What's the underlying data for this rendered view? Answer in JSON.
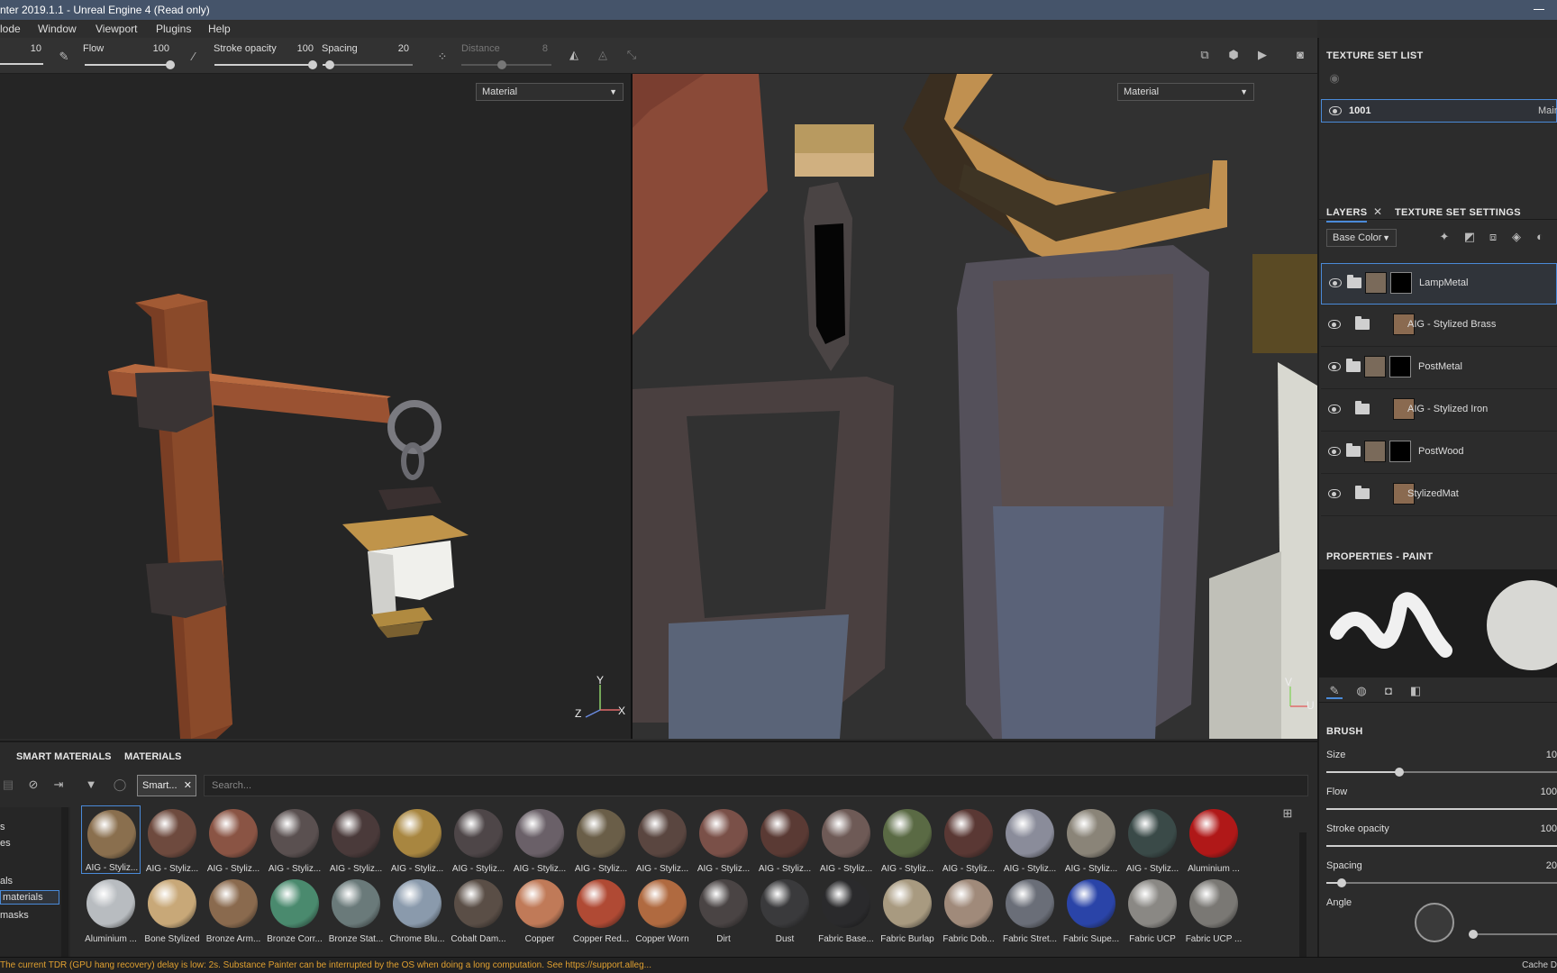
{
  "window": {
    "title": "nter 2019.1.1 - Unreal Engine 4 (Read only)"
  },
  "menu": [
    "lode",
    "Window",
    "Viewport",
    "Plugins",
    "Help"
  ],
  "toolbar": {
    "size_value": "10",
    "flow_label": "Flow",
    "flow_value": "100",
    "stroke_label": "Stroke opacity",
    "stroke_value": "100",
    "spacing_label": "Spacing",
    "spacing_value": "20",
    "distance_label": "Distance",
    "distance_value": "8"
  },
  "viewport3d": {
    "mode": "Material",
    "axes": {
      "y": "Y",
      "z": "Z",
      "x": "X"
    }
  },
  "viewport2d": {
    "mode": "Material",
    "axes": {
      "v": "V",
      "u": "U"
    }
  },
  "texture_set_list": {
    "title": "TEXTURE SET LIST",
    "row_name": "1001",
    "row_shader": "Main"
  },
  "layers": {
    "tab_layers": "LAYERS",
    "tab_settings": "TEXTURE SET SETTINGS",
    "channel": "Base Color",
    "items": [
      {
        "name": "LampMetal",
        "folder": true,
        "mask": true
      },
      {
        "name": "AIG - Stylized Brass",
        "folder": false,
        "mask": false
      },
      {
        "name": "PostMetal",
        "folder": true,
        "mask": true
      },
      {
        "name": "AIG - Stylized Iron",
        "folder": false,
        "mask": false
      },
      {
        "name": "PostWood",
        "folder": true,
        "mask": true
      },
      {
        "name": "StylizedMat",
        "folder": false,
        "mask": false
      }
    ]
  },
  "properties": {
    "title": "PROPERTIES - PAINT",
    "brush_title": "BRUSH",
    "size_label": "Size",
    "size_value": "10",
    "flow_label": "Flow",
    "flow_value": "100",
    "stroke_label": "Stroke opacity",
    "stroke_value": "100",
    "spacing_label": "Spacing",
    "spacing_value": "20",
    "angle_label": "Angle"
  },
  "shelf": {
    "tab_smart": "SMART MATERIALS",
    "tab_materials": "MATERIALS",
    "filter_chip": "Smart...",
    "search_placeholder": "Search...",
    "side_items": [
      "s",
      "es",
      "als",
      "materials",
      "masks"
    ],
    "row1": [
      {
        "label": "AIG - Styliz...",
        "color": "#8a6f4e"
      },
      {
        "label": "AIG - Styliz...",
        "color": "#6e4a3e"
      },
      {
        "label": "AIG - Styliz...",
        "color": "#8a5444"
      },
      {
        "label": "AIG - Styliz...",
        "color": "#5a5050"
      },
      {
        "label": "AIG - Styliz...",
        "color": "#4a3a3a"
      },
      {
        "label": "AIG - Styliz...",
        "color": "#a88640"
      },
      {
        "label": "AIG - Styliz...",
        "color": "#4e4648"
      },
      {
        "label": "AIG - Styliz...",
        "color": "#6a6068"
      },
      {
        "label": "AIG - Styliz...",
        "color": "#6a5e48"
      },
      {
        "label": "AIG - Styliz...",
        "color": "#5a4640"
      },
      {
        "label": "AIG - Styliz...",
        "color": "#7a5048"
      },
      {
        "label": "AIG - Styliz...",
        "color": "#5a3a34"
      },
      {
        "label": "AIG - Styliz...",
        "color": "#6e5a56"
      },
      {
        "label": "AIG - Styliz...",
        "color": "#5a6a44"
      },
      {
        "label": "AIG - Styliz...",
        "color": "#5a3834"
      },
      {
        "label": "AIG - Styliz...",
        "color": "#8a8c9a"
      },
      {
        "label": "AIG - Styliz...",
        "color": "#8a8478"
      },
      {
        "label": "AIG - Styliz...",
        "color": "#3a4a48"
      },
      {
        "label": "Aluminium ...",
        "color": "#b01818"
      }
    ],
    "row2": [
      {
        "label": "Aluminium ...",
        "color": "#b8bcc0"
      },
      {
        "label": "Bone Stylized",
        "color": "#c8a878"
      },
      {
        "label": "Bronze Arm...",
        "color": "#8a6a4e"
      },
      {
        "label": "Bronze Corr...",
        "color": "#4a8a6e"
      },
      {
        "label": "Bronze Stat...",
        "color": "#6a7a7a"
      },
      {
        "label": "Chrome Blu...",
        "color": "#8a9aac"
      },
      {
        "label": "Cobalt Dam...",
        "color": "#5a4e46"
      },
      {
        "label": "Copper",
        "color": "#c07a58"
      },
      {
        "label": "Copper Red...",
        "color": "#b04a34"
      },
      {
        "label": "Copper Worn",
        "color": "#b06a40"
      },
      {
        "label": "Dirt",
        "color": "#4a4444"
      },
      {
        "label": "Dust",
        "color": "#3a3a3c"
      },
      {
        "label": "Fabric Base...",
        "color": "#2a2a2c"
      },
      {
        "label": "Fabric Burlap",
        "color": "#a89a80"
      },
      {
        "label": "Fabric Dob...",
        "color": "#a08a7a"
      },
      {
        "label": "Fabric Stret...",
        "color": "#6a6e78"
      },
      {
        "label": "Fabric Supe...",
        "color": "#2a44a8"
      },
      {
        "label": "Fabric UCP",
        "color": "#8a8884"
      },
      {
        "label": "Fabric UCP ...",
        "color": "#7a7874"
      }
    ]
  },
  "status": {
    "message": "The current TDR (GPU hang recovery) delay is low: 2s. Substance Painter can be interrupted by the OS when doing a long computation. See https://support.alleg...",
    "cache": "Cache D"
  }
}
